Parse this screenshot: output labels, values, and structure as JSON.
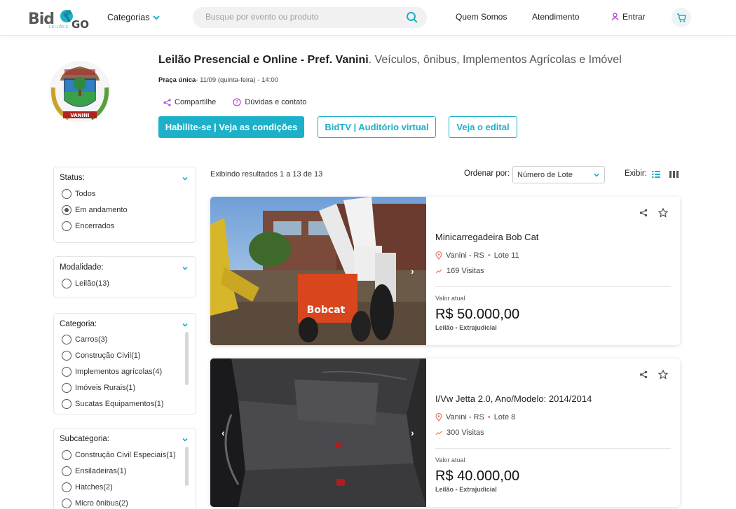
{
  "header": {
    "logo_bid": "Bid",
    "logo_go": "GO",
    "logo_sub": "LEILÕES",
    "categories_label": "Categorias",
    "search_placeholder": "Busque por evento ou produto",
    "nav_about": "Quem Somos",
    "nav_support": "Atendimento",
    "nav_login": "Entrar"
  },
  "auction": {
    "seal_text": "VANINI",
    "title_bold": "Leilão Presencial e Online - Pref. Vanini",
    "title_rest": ". Veículos, ônibus, Implementos Agrícolas e Imóvel",
    "praca_label": "Praça única",
    "praca_date": "- 11/09 (quinta-feira) - 14:00",
    "share_label": "Compartilhe",
    "doubts_label": "Dúvidas e contato",
    "btn_habilite": "Habilite-se | Veja as condições",
    "btn_bidtv": "BidTV | Auditório virtual",
    "btn_edital": "Veja o edital"
  },
  "filters": {
    "status": {
      "title": "Status:",
      "options": [
        "Todos",
        "Em andamento",
        "Encerrados"
      ],
      "selected": "Em andamento"
    },
    "modalidade": {
      "title": "Modalidade:",
      "options": [
        "Leilão(13)"
      ]
    },
    "categoria": {
      "title": "Categoria:",
      "options": [
        "Carros(3)",
        "Construção Civil(1)",
        "Implementos agrícolas(4)",
        "Imóveis Rurais(1)",
        "Sucatas Equipamentos(1)"
      ]
    },
    "subcategoria": {
      "title": "Subcategoria:",
      "options": [
        "Construção Civil Especiais(1)",
        "Ensiladeiras(1)",
        "Hatches(2)",
        "Micro ônibus(2)"
      ]
    }
  },
  "results": {
    "summary": "Exibindo resultados 1 a 13 de 13",
    "order_label": "Ordenar por:",
    "order_value": "Número de Lote",
    "view_label": "Exibir:"
  },
  "lots": [
    {
      "title": "Minicarregadeira Bob Cat",
      "location": "Vanini - RS",
      "lot": "Lote 11",
      "visits": "169 Visitas",
      "value_label": "Valor atual",
      "price": "R$ 50.000,00",
      "type": "Leilão",
      "kind": "Extrajudicial",
      "photo_brand": "Bobcat"
    },
    {
      "title": "I/Vw Jetta 2.0, Ano/Modelo: 2014/2014",
      "location": "Vanini - RS",
      "lot": "Lote 8",
      "visits": "300 Visitas",
      "value_label": "Valor atual",
      "price": "R$ 40.000,00",
      "type": "Leilão",
      "kind": "Extrajudicial"
    }
  ],
  "colors": {
    "accent": "#1cb0c9",
    "dot": "#e07a5f",
    "login_icon": "#b14fd1"
  }
}
